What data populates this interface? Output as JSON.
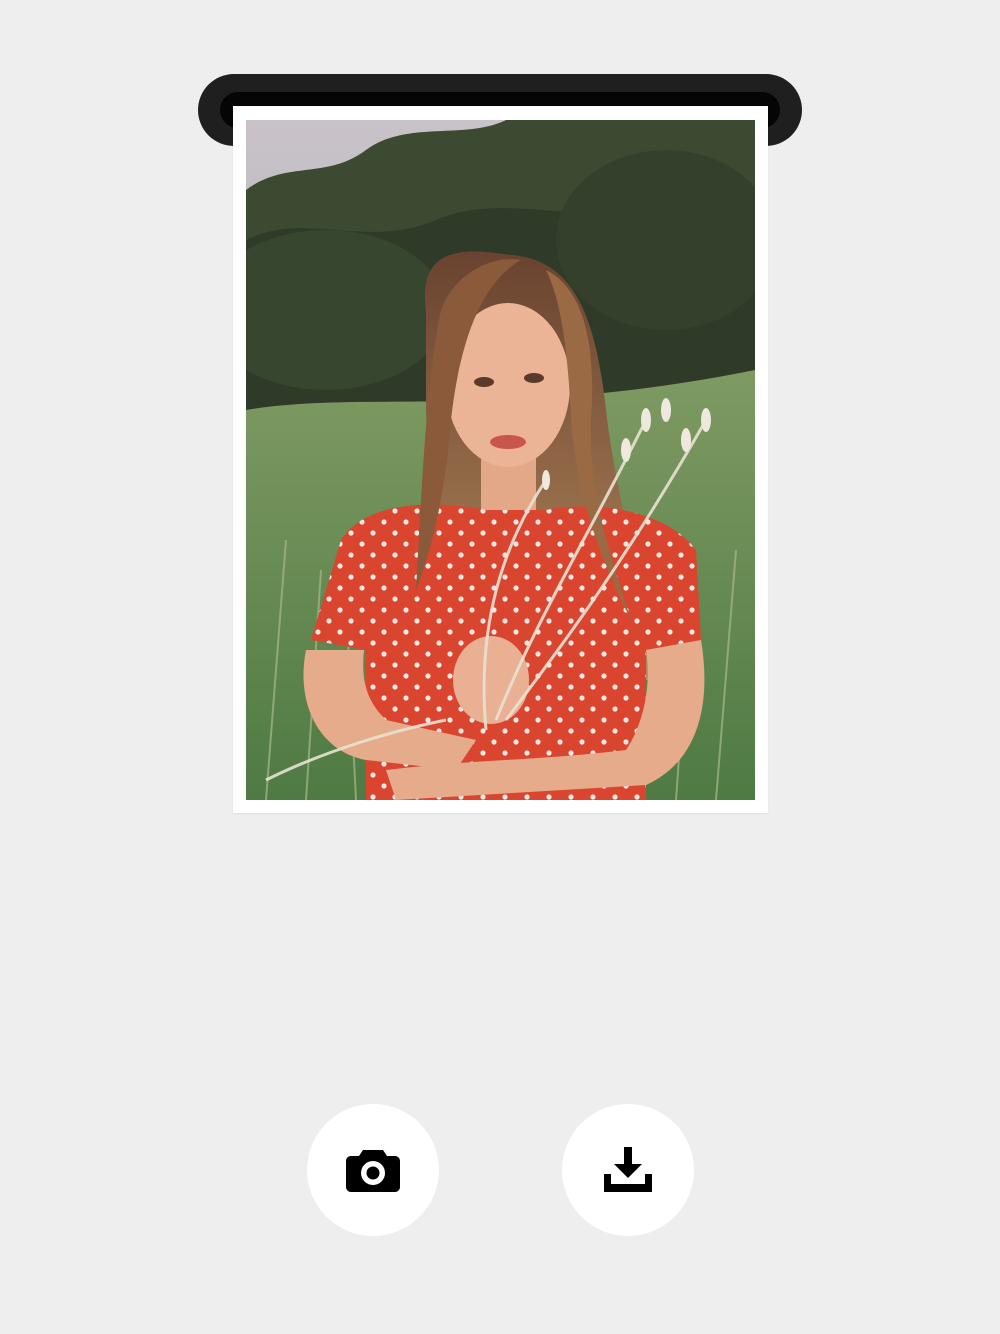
{
  "theme": {
    "background": "#eeeeee",
    "button_background": "#ffffff",
    "icon_color": "#000000",
    "printer_slot_color": "#1f1f1f"
  },
  "printer": {
    "photo": {
      "subject": "portrait-photo"
    }
  },
  "actions": [
    {
      "id": "camera",
      "icon": "camera-icon"
    },
    {
      "id": "download",
      "icon": "download-icon"
    }
  ]
}
